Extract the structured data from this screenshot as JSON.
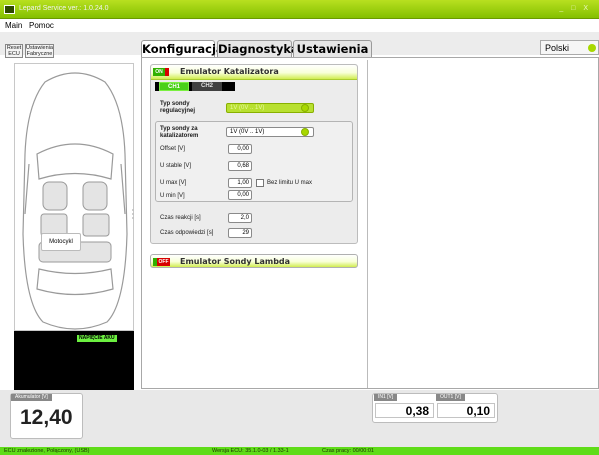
{
  "window": {
    "title": "Lepard Service ver.: 1.0.24.0",
    "controls": "_ □ X"
  },
  "menu": {
    "items": [
      {
        "label": "Main"
      },
      {
        "label": "Pomoc"
      }
    ]
  },
  "toolbar": {
    "reset_label": "Reset ECU",
    "defaults_label": "Ustawienia Fabryczne"
  },
  "tabs": [
    {
      "label": "Konfiguracja"
    },
    {
      "label": "Diagnostyka"
    },
    {
      "label": "Ustawienia"
    }
  ],
  "language": {
    "selected": "Polski"
  },
  "vehicle": {
    "motorcycle_label": "Motocykl"
  },
  "voltage_indicator": {
    "label": "NAPIĘCIE AKU"
  },
  "catalyst_emulator": {
    "toggle": "ON",
    "title": "Emulator Katalizatora",
    "channels": [
      {
        "label": "CH1"
      },
      {
        "label": "CH2"
      }
    ],
    "regulating_probe": {
      "label": "Typ sondy regulacyjnej",
      "value": "1V (0V .. 1V)"
    },
    "post_cat_probe": {
      "label": "Typ sondy za katalizatorem",
      "value": "1V (0V .. 1V)"
    },
    "offset": {
      "label": "Offset [V]",
      "value": "0,00"
    },
    "u_stable": {
      "label": "U stable [V]",
      "value": "0,68"
    },
    "u_max": {
      "label": "U max [V]",
      "value": "1,00",
      "checkbox_label": "Bez limitu U max"
    },
    "u_min": {
      "label": "U min [V]",
      "value": "0,00"
    },
    "reaction_time": {
      "label": "Czas reakcji [s]",
      "value": "2,0"
    },
    "response_time": {
      "label": "Czas odpowiedzi [s]",
      "value": "29"
    }
  },
  "lambda_emulator": {
    "toggle": "OFF",
    "title": "Emulator Sondy Lambda"
  },
  "battery": {
    "label": "Akumulator [V]",
    "value": "12,40"
  },
  "readouts": {
    "in_label": "IN1 [V]",
    "in_value": "0,38",
    "out_label": "OUT1 [V]",
    "out_value": "0,10"
  },
  "status": {
    "connection": "ECU znalezione, Połączony, (USB)",
    "version": "Wersja ECU: 35.1.0-03 / 1.33-1",
    "uptime": "Czas pracy: 00/00:01"
  }
}
